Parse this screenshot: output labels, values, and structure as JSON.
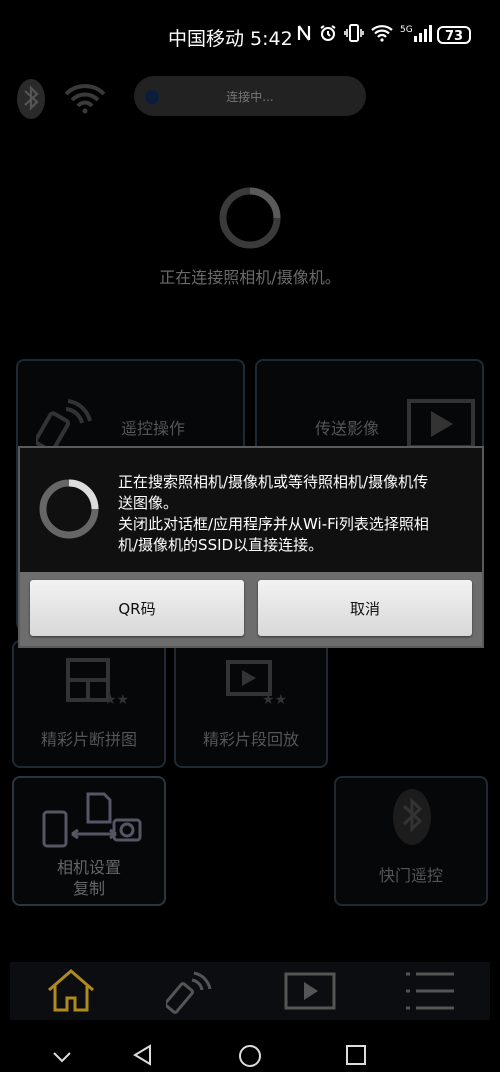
{
  "status_bar": {
    "time": "中国移动 5:42",
    "battery": "73",
    "icons": [
      "nfc-icon",
      "alarm-icon",
      "vibrate-icon",
      "wifi-icon",
      "signal-5g-icon"
    ]
  },
  "connection": {
    "status": "连接中...",
    "message": "正在连接照相机/摄像机。"
  },
  "menu": {
    "remote": "遥控操作",
    "transfer": "传送影像",
    "highlight_collage": "精彩片断拼图",
    "highlight_playback": "精彩片段回放",
    "copy_settings_line1": "相机设置",
    "copy_settings_line2": "复制",
    "shutter_remote": "快门遥控"
  },
  "dialog": {
    "line1": "正在搜索照相机/摄像机或等待照相机/摄像机传",
    "line2": "送图像。",
    "line3": "关闭此对话框/应用程序并从Wi-Fi列表选择照相",
    "line4": "机/摄像机的SSID以直接连接。",
    "qr_button": "QR码",
    "cancel_button": "取消"
  },
  "colors": {
    "accent_home": "#b08a1e",
    "dialog_bg": "#101010",
    "dialog_footer": "#6d6d6d"
  }
}
